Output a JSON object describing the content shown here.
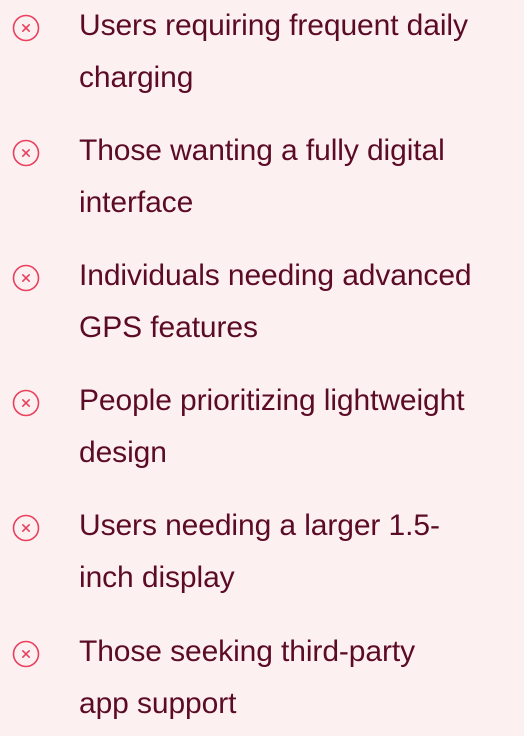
{
  "colors": {
    "background": "#fdf0f0",
    "text": "#5c0b26",
    "icon": "#e8405f"
  },
  "items": [
    {
      "icon": "circle-x-icon",
      "line1": "Users requiring frequent daily",
      "line2": "charging"
    },
    {
      "icon": "circle-x-icon",
      "line1": "Those wanting a fully digital",
      "line2": "interface"
    },
    {
      "icon": "circle-x-icon",
      "line1": "Individuals needing advanced",
      "line2": "GPS features"
    },
    {
      "icon": "circle-x-icon",
      "line1": "People prioritizing lightweight",
      "line2": "design"
    },
    {
      "icon": "circle-x-icon",
      "line1": "Users needing a larger 1.5-",
      "line2": "inch display"
    },
    {
      "icon": "circle-x-icon",
      "line1": "Those seeking third-party",
      "line2": "app support"
    }
  ]
}
